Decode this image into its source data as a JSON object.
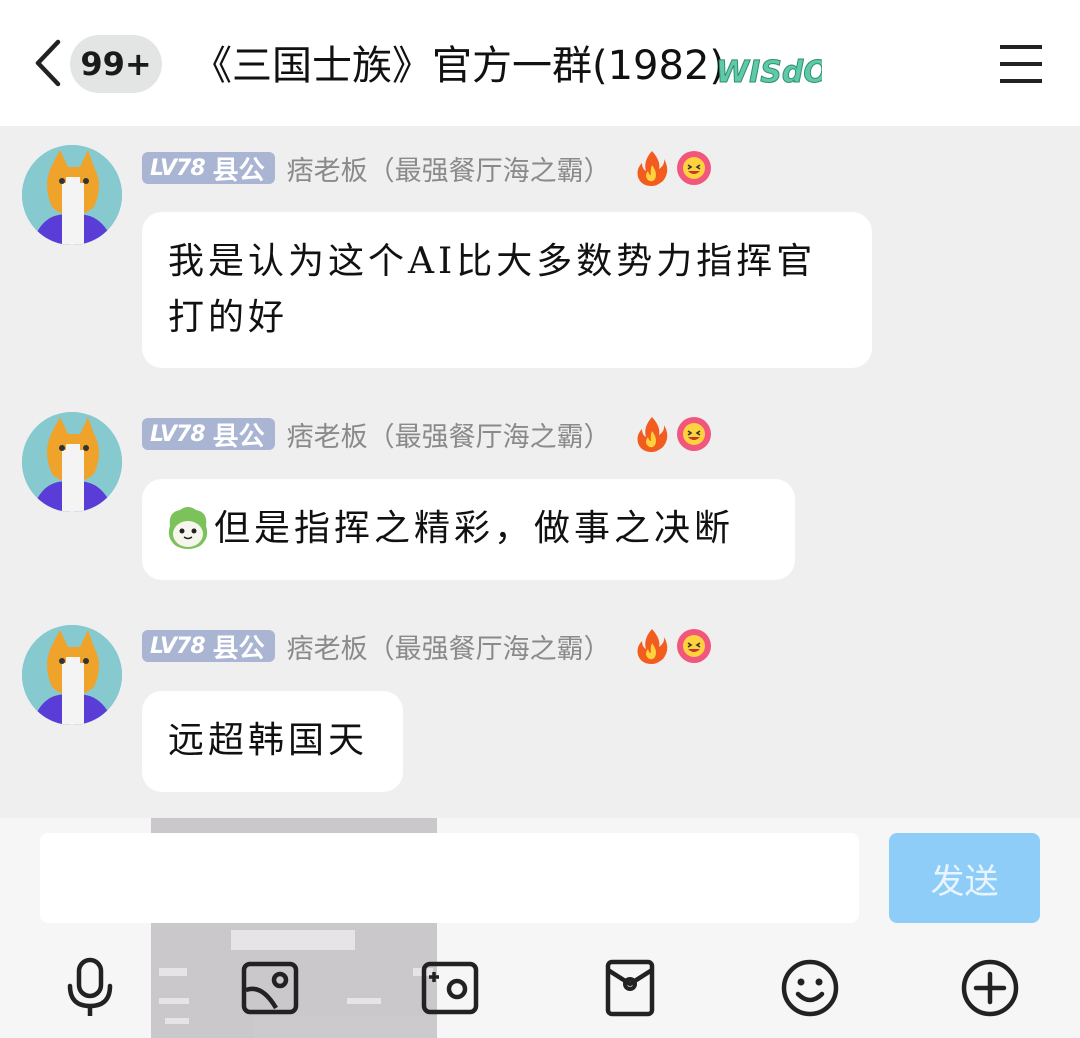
{
  "header": {
    "unread_count": "99+",
    "title": "《三国士族》官方一群(1982)",
    "title_badge_text": "WISdOM"
  },
  "messages": [
    {
      "level": "LV78",
      "rank": "县公",
      "sender": "痞老板（最强餐厅海之霸）",
      "text": "我是认为这个AI比大多数势力指挥官打的好",
      "has_sticker": false
    },
    {
      "level": "LV78",
      "rank": "县公",
      "sender": "痞老板（最强餐厅海之霸）",
      "text": "但是指挥之精彩，做事之决断",
      "has_sticker": true
    },
    {
      "level": "LV78",
      "rank": "县公",
      "sender": "痞老板（最强餐厅海之霸）",
      "text": "远超韩国天",
      "has_sticker": false
    }
  ],
  "input": {
    "value": "",
    "send_label": "发送"
  },
  "toolbar": [
    "mic-icon",
    "image-icon",
    "camera-icon",
    "red-packet-icon",
    "emoji-icon",
    "plus-icon"
  ],
  "colors": {
    "level_tag": "#a9b5d3",
    "send_button": "#8fcdf9",
    "chat_background": "#efefef"
  }
}
